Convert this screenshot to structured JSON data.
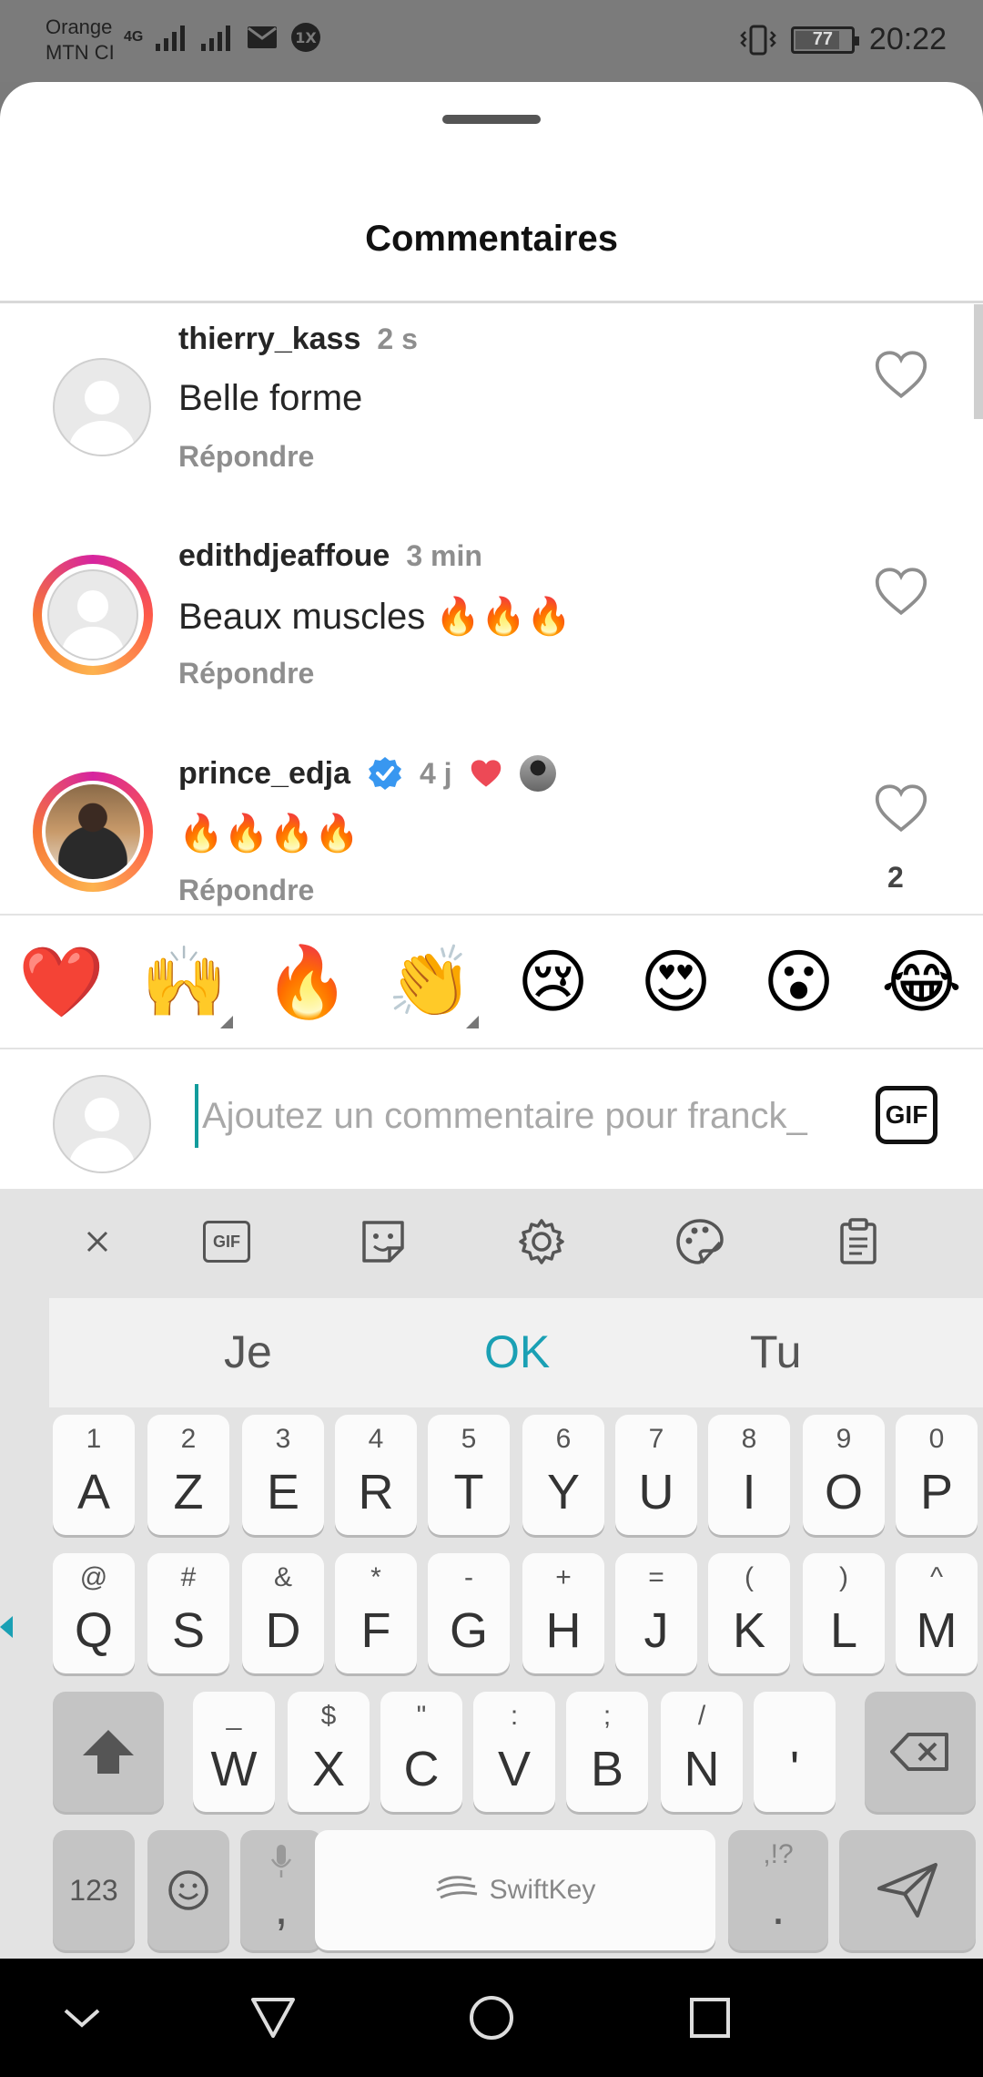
{
  "status_bar": {
    "carrier_1": "Orange",
    "carrier_2": "MTN CI",
    "network": "4G",
    "battery": "77",
    "time": "20:22"
  },
  "sheet": {
    "title": "Commentaires"
  },
  "comments": [
    {
      "username": "thierry_kass",
      "time": "2 s",
      "text": "Belle forme",
      "reply_label": "Répondre",
      "avatar": "default",
      "story_ring": false
    },
    {
      "username": "edithdjeaffoue",
      "time": "3 min",
      "text": "Beaux muscles 🔥🔥🔥",
      "reply_label": "Répondre",
      "avatar": "default",
      "story_ring": true
    },
    {
      "username": "prince_edja",
      "time": "4 j",
      "text": "🔥🔥🔥🔥",
      "reply_label": "Répondre",
      "avatar": "photo",
      "story_ring": true,
      "verified": true,
      "liked_by_author": true,
      "like_count": "2"
    }
  ],
  "emoji_bar": [
    "❤️",
    "🙌",
    "🔥",
    "👏",
    "😢",
    "😍",
    "😮",
    "😂"
  ],
  "comment_input": {
    "value": "",
    "placeholder": "Ajoutez un commentaire pour franck_",
    "gif_label": "GIF"
  },
  "keyboard": {
    "toolbar_gif_label": "GIF",
    "suggestions": [
      "Je",
      "OK",
      "Tu"
    ],
    "row1": [
      {
        "sub": "1",
        "main": "A"
      },
      {
        "sub": "2",
        "main": "Z"
      },
      {
        "sub": "3",
        "main": "E"
      },
      {
        "sub": "4",
        "main": "R"
      },
      {
        "sub": "5",
        "main": "T"
      },
      {
        "sub": "6",
        "main": "Y"
      },
      {
        "sub": "7",
        "main": "U"
      },
      {
        "sub": "8",
        "main": "I"
      },
      {
        "sub": "9",
        "main": "O"
      },
      {
        "sub": "0",
        "main": "P"
      }
    ],
    "row2": [
      {
        "sub": "@",
        "main": "Q"
      },
      {
        "sub": "#",
        "main": "S"
      },
      {
        "sub": "&",
        "main": "D"
      },
      {
        "sub": "*",
        "main": "F"
      },
      {
        "sub": "-",
        "main": "G"
      },
      {
        "sub": "+",
        "main": "H"
      },
      {
        "sub": "=",
        "main": "J"
      },
      {
        "sub": "(",
        "main": "K"
      },
      {
        "sub": ")",
        "main": "L"
      },
      {
        "sub": "^",
        "main": "M"
      }
    ],
    "row3": [
      {
        "sub": "_",
        "main": "W"
      },
      {
        "sub": "$",
        "main": "X"
      },
      {
        "sub": "\"",
        "main": "C"
      },
      {
        "sub": ":",
        "main": "V"
      },
      {
        "sub": ";",
        "main": "B"
      },
      {
        "sub": "/",
        "main": "N"
      },
      {
        "sub": "",
        "main": "'"
      }
    ],
    "numbers_label": "123",
    "comma_label": ",",
    "period_label": ".",
    "period_sub": ",!?",
    "space_label": "SwiftKey"
  },
  "colors": {
    "accent": "#1aa0b4",
    "heart": "#ed4956",
    "verified": "#3897f0",
    "story_ring": "#d6249f"
  }
}
